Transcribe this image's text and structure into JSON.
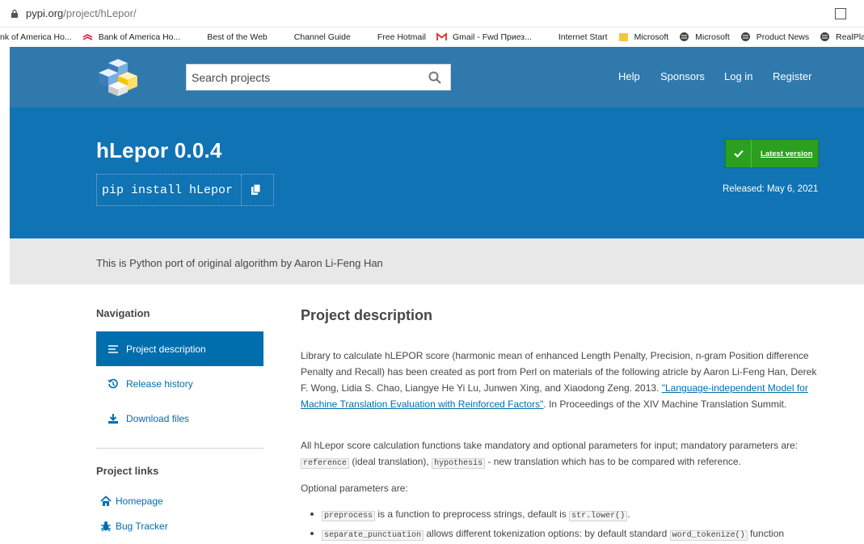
{
  "browser": {
    "url_host": "pypi.org",
    "url_path": "/project/hLepor/",
    "bookmarks": [
      {
        "label": "nk of America Ho...",
        "icon": "none"
      },
      {
        "label": "Bank of America Ho...",
        "icon": "bank-of-america-icon"
      },
      {
        "label": "Best of the Web",
        "icon": "windows-logo-icon"
      },
      {
        "label": "Channel Guide",
        "icon": "windows-logo-icon"
      },
      {
        "label": "Free Hotmail",
        "icon": "windows-logo-icon"
      },
      {
        "label": "Gmail - Fwd Приез...",
        "icon": "gmail-icon"
      },
      {
        "label": "Internet Start",
        "icon": "windows-logo-icon"
      },
      {
        "label": "Microsoft",
        "icon": "folder-icon"
      },
      {
        "label": "Microsoft",
        "icon": "globe-icon"
      },
      {
        "label": "Product News",
        "icon": "globe-icon"
      },
      {
        "label": "RealPlayer",
        "icon": "globe-icon"
      }
    ]
  },
  "header": {
    "search_placeholder": "Search projects",
    "nav": [
      "Help",
      "Sponsors",
      "Log in",
      "Register"
    ]
  },
  "hero": {
    "title": "hLepor 0.0.4",
    "pip_command": "pip install hLepor",
    "latest_label": "Latest version",
    "released": "Released: May 6, 2021"
  },
  "summary": "This is Python port of original algorithm by Aaron Li-Feng Han",
  "sidebar": {
    "navigation_heading": "Navigation",
    "nav_items": [
      {
        "label": "Project description",
        "icon": "list-icon",
        "active": true
      },
      {
        "label": "Release history",
        "icon": "history-icon",
        "active": false
      },
      {
        "label": "Download files",
        "icon": "download-icon",
        "active": false
      }
    ],
    "links_heading": "Project links",
    "links": [
      {
        "label": "Homepage",
        "icon": "home-icon"
      },
      {
        "label": "Bug Tracker",
        "icon": "bug-icon"
      }
    ]
  },
  "main": {
    "heading": "Project description",
    "p1_text": "Library to calculate hLEPOR score (harmonic mean of enhanced Length Penalty, Precision, n-gram Position difference Penalty and Recall) has been created as port from Perl on materials of the following atricle by Aaron Li-Feng Han, Derek F. Wong, Lidia S. Chao, Liangye He Yi Lu, Junwen Xing, and Xiaodong Zeng. 2013. ",
    "p1_link": "\"Language-independent Model for Machine Translation Evaluation with Reinforced Factors\"",
    "p1_tail": ". In Proceedings of the XIV Machine Translation Summit.",
    "p2_text": "All hLepor score calculation functions take mandatory and optional parameters for input; mandatory parameters are:",
    "p2_code1": "reference",
    "p2_mid": " (ideal translation), ",
    "p2_code2": "hypothesis",
    "p2_tail": " - new translation which has to be compared with reference.",
    "p3": "Optional parameters are:",
    "b1_code": "preprocess",
    "b1_text": " is a function to preprocess strings, default is ",
    "b1_code2": "str.lower()",
    "b1_tail": ".",
    "b2_code": "separate_punctuation",
    "b2_text": " allows different tokenization options: by default standard ",
    "b2_code2": "word_tokenize()",
    "b2_tail": " function"
  },
  "colors": {
    "nav_bg": "#2f79ad",
    "hero_bg": "#0f73b4",
    "summary_bg": "#e8e8e8",
    "active_bg": "#006dad",
    "latest_green": "#2b9f1f",
    "link": "#006dad"
  }
}
